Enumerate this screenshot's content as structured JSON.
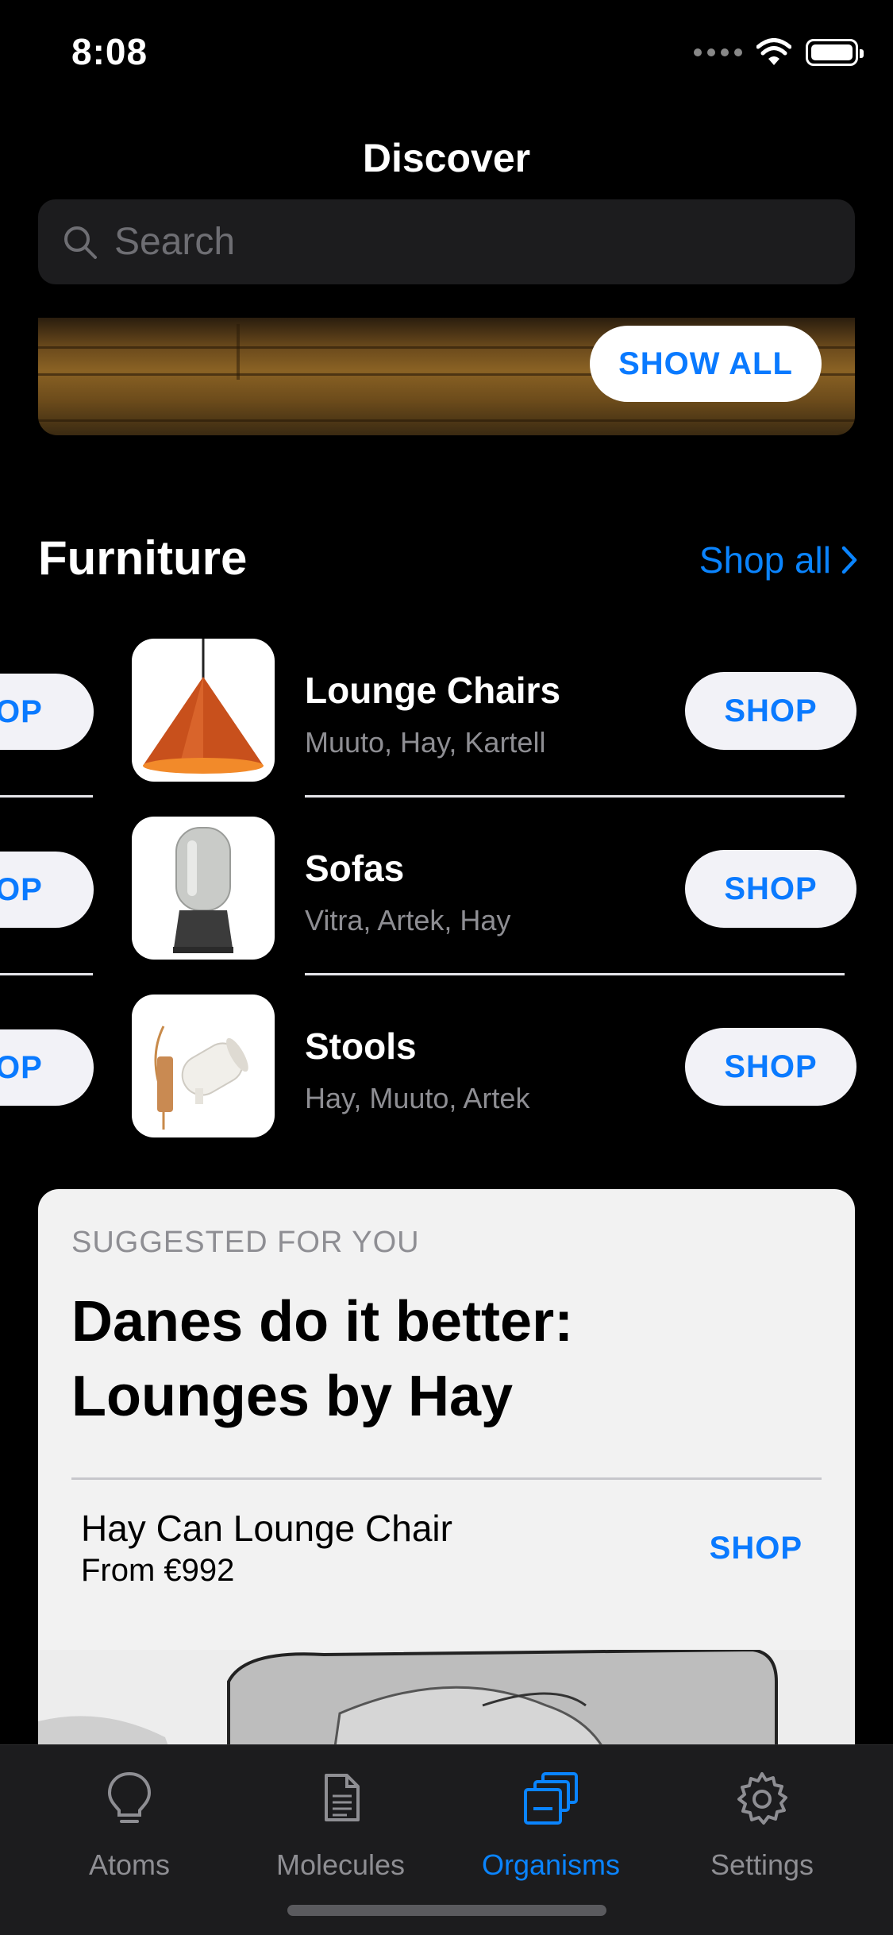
{
  "status_bar": {
    "time": "8:08"
  },
  "header": {
    "title": "Discover"
  },
  "search": {
    "placeholder": "Search"
  },
  "banner": {
    "button_label": "SHOW ALL"
  },
  "section": {
    "title": "Furniture",
    "link_label": "Shop all"
  },
  "carousel": {
    "peek_button_label": "HOP",
    "items": [
      {
        "name": "Lounge Chairs",
        "brands": "Muuto, Hay, Kartell",
        "button_label": "SHOP",
        "thumb_icon": "pendant-lamp-icon"
      },
      {
        "name": "Sofas",
        "brands": "Vitra, Artek, Hay",
        "button_label": "SHOP",
        "thumb_icon": "table-lamp-icon"
      },
      {
        "name": "Stools",
        "brands": "Hay, Muuto, Artek",
        "button_label": "SHOP",
        "thumb_icon": "wall-lamp-icon"
      }
    ]
  },
  "suggested": {
    "eyebrow": "SUGGESTED FOR YOU",
    "headline_line1": "Danes do it better:",
    "headline_line2": "Lounges by Hay",
    "product_name": "Hay Can Lounge Chair",
    "product_price": "From €992",
    "button_label": "SHOP"
  },
  "tabbar": {
    "tabs": [
      {
        "label": "Atoms",
        "icon": "lightbulb-icon",
        "active": false
      },
      {
        "label": "Molecules",
        "icon": "document-icon",
        "active": false
      },
      {
        "label": "Organisms",
        "icon": "stacked-squares-icon",
        "active": true
      },
      {
        "label": "Settings",
        "icon": "gear-icon",
        "active": false
      }
    ]
  },
  "colors": {
    "accent": "#0a84ff",
    "background": "#000000",
    "card": "#f2f2f2"
  }
}
